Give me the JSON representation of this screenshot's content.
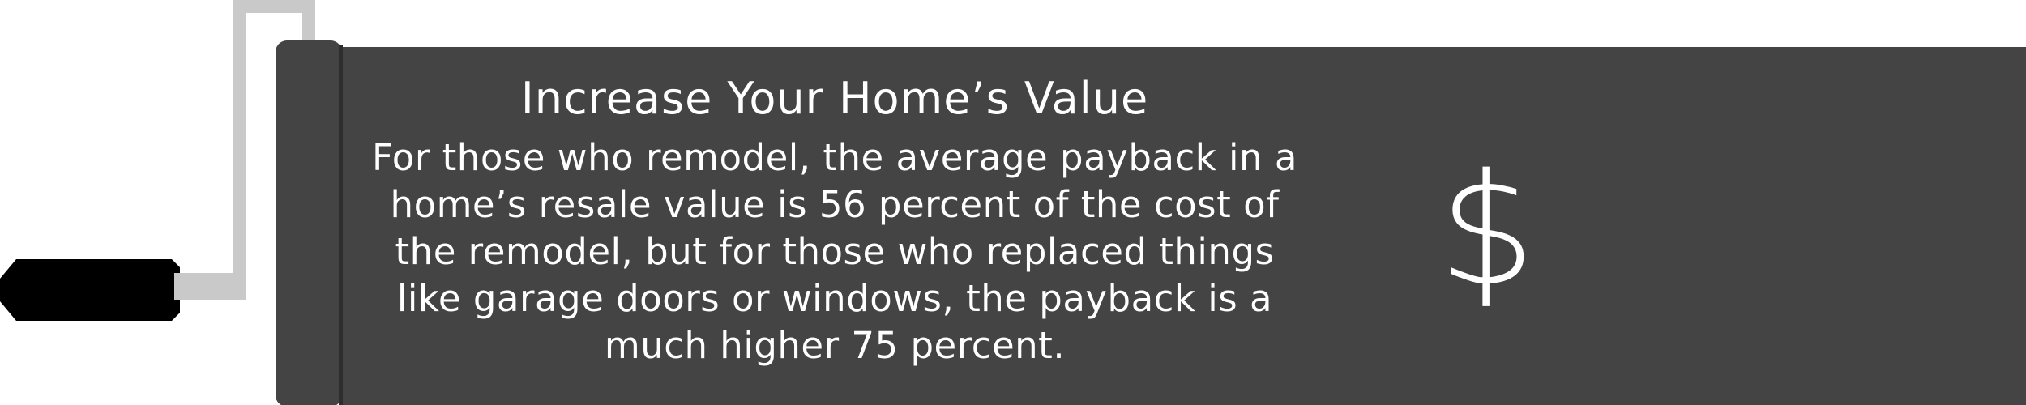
{
  "banner": {
    "title": "Increase Your Home’s Value",
    "body": "For those who remodel, the average payback in a home’s resale value is 56 percent of the cost of the remodel, but for those who replaced things like garage doors or windows, the payback is a much higher 75 percent.",
    "icon": "dollar-sign-icon",
    "icon_glyph": "$"
  },
  "colors": {
    "banner": "#444444",
    "frame": "#c9c9c9",
    "handle": "#000000",
    "text": "#ffffff"
  }
}
